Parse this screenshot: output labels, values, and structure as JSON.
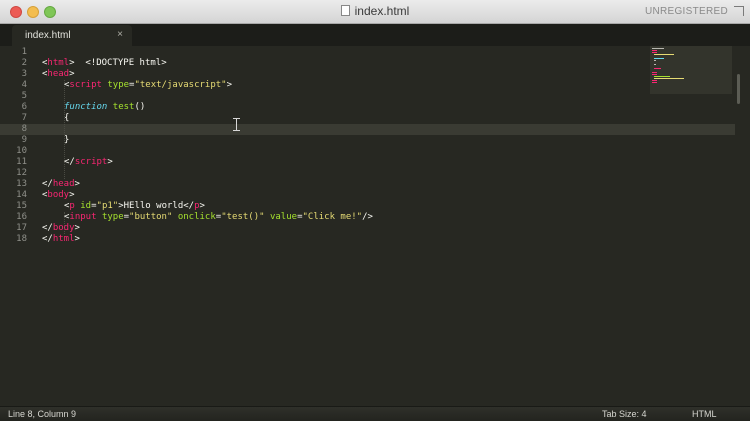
{
  "window": {
    "title": "index.html",
    "registration": "UNREGISTERED"
  },
  "tab": {
    "label": "index.html",
    "close_glyph": "×"
  },
  "gutter": {
    "line_numbers": [
      "1",
      "2",
      "3",
      "4",
      "5",
      "6",
      "7",
      "8",
      "9",
      "10",
      "11",
      "12",
      "13",
      "14",
      "15",
      "16",
      "17",
      "18"
    ]
  },
  "code": {
    "l1": "<!DOCTYPE html>",
    "l2_lt": "<",
    "l2_tag": "html",
    "l2_gt": ">",
    "l3_lt": "<",
    "l3_tag": "head",
    "l3_gt": ">",
    "l4_lt": "<",
    "l4_tag": "script",
    "l4_attr": "type",
    "l4_eq": "=",
    "l4_val": "\"text/javascript\"",
    "l4_gt": ">",
    "l6_kw": "function",
    "l6_name": "test",
    "l6_paren": "()",
    "l7": "{",
    "l9": "}",
    "l11_lt": "</",
    "l11_tag": "script",
    "l11_gt": ">",
    "l13_lt": "</",
    "l13_tag": "head",
    "l13_gt": ">",
    "l14_lt": "<",
    "l14_tag": "body",
    "l14_gt": ">",
    "l15_lt": "<",
    "l15_tag": "p",
    "l15_attr": "id",
    "l15_eq": "=",
    "l15_val": "\"p1\"",
    "l15_text": ">HEllo world</",
    "l15_tag2": "p",
    "l15_gt": ">",
    "l16_lt": "<",
    "l16_tag": "input",
    "l16_attr1": "type",
    "l16_eq1": "=",
    "l16_val1": "\"button\"",
    "l16_attr2": "onclick",
    "l16_eq2": "=",
    "l16_val2": "\"test()\"",
    "l16_attr3": "value",
    "l16_eq3": "=",
    "l16_val3": "\"Click me!\"",
    "l16_gt": "/>",
    "l17_lt": "</",
    "l17_tag": "body",
    "l17_gt": ">",
    "l18_lt": "</",
    "l18_tag": "html",
    "l18_gt": ">"
  },
  "statusbar": {
    "position": "Line 8, Column 9",
    "tab_size": "Tab Size: 4",
    "syntax": "HTML"
  },
  "colors": {
    "background": "#272822",
    "tag": "#f92672",
    "attribute": "#a6e22e",
    "string": "#e6db74",
    "keyword": "#66d9ef",
    "text": "#f8f8f2"
  }
}
